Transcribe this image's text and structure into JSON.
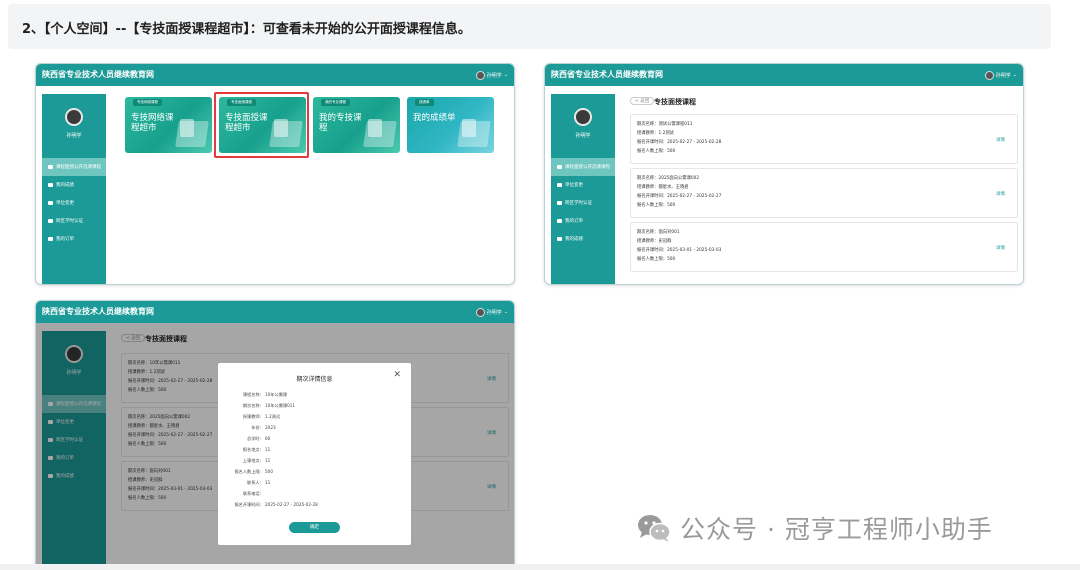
{
  "heading": "2、【个人空间】--【专技面授课程超市】：可查看未开始的公开面授课程信息。",
  "common": {
    "site_title": "陕西省专业技术人员继续教育网",
    "user_name": "孙明学",
    "caret": "⌄",
    "side_name": "孙明学"
  },
  "shot1": {
    "menu": [
      "课程面授公开选课课程",
      "我的成绩",
      "单位变更",
      "跨区学时认证",
      "我的订单"
    ],
    "tiles": [
      {
        "tag": "专技网络课程",
        "label": "专技网络课程超市"
      },
      {
        "tag": "专技面授课程",
        "label": "专技面授课程超市"
      },
      {
        "tag": "我的专业课程",
        "label": "我的专技课程"
      },
      {
        "tag": "成绩单",
        "label": "我的成绩单"
      }
    ]
  },
  "shot2": {
    "menu": [
      "课程面授公开选课课程",
      "单位变更",
      "跨区学时认证",
      "我的订单",
      "我的成绩"
    ],
    "back": "< 返回",
    "title": "专技面授课程",
    "detail": "详情",
    "courses": [
      [
        "期次名称：测试公需课程011",
        "授课教师：1.2测试",
        "报名开课时间：2025-02-27 - 2025-02-28",
        "报名人数上限：500"
      ],
      [
        "期次名称：2025面向公需课002",
        "授课教师：都星水、王晓君",
        "报名开课时间：2025-02-27 - 2025-02-27",
        "报名人数上限：500"
      ],
      [
        "期次名称：面向对001",
        "授课教师：史冠群",
        "报名开课时间：2025-03-01 - 2025-03-03",
        "报名人数上限：500"
      ]
    ]
  },
  "shot3": {
    "menu": [
      "课程面授公开选课课程",
      "单位变更",
      "跨区学时认证",
      "我的订单",
      "我的成绩"
    ],
    "back": "< 返回",
    "title": "专技面授课程",
    "detail": "详情",
    "courses": [
      [
        "期次名称：10年公需课011",
        "授课教师：1.2测试",
        "报名开课时间：2025-02-27 - 2025-02-28",
        "报名人数上限：500"
      ],
      [
        "期次名称：2025面向公需课002",
        "授课教师：都星水、王晓君",
        "报名开课时间：2025-02-27 - 2025-02-27",
        "报名人数上限：500"
      ],
      [
        "期次名称：面向对001",
        "授课教师：史冠群",
        "报名开课时间：2025-03-01 - 2025-03-03",
        "报名人数上限：500"
      ]
    ],
    "modal": {
      "title": "期次详情信息",
      "close": "✕",
      "rows": [
        {
          "k": "课程名称:",
          "v": "10年公需课"
        },
        {
          "k": "期次名称:",
          "v": "10年公需课011"
        },
        {
          "k": "授课教师:",
          "v": "1.2测试"
        },
        {
          "k": "年份:",
          "v": "2023"
        },
        {
          "k": "总学时:",
          "v": "60"
        },
        {
          "k": "报名地点:",
          "v": "11"
        },
        {
          "k": "上课地点:",
          "v": "11"
        },
        {
          "k": "报名人数上限:",
          "v": "500"
        },
        {
          "k": "联系人:",
          "v": "11"
        },
        {
          "k": "联系电话:",
          "v": ""
        },
        {
          "k": "报名开课时间:",
          "v": "2025-02-27 - 2025-02-28"
        }
      ],
      "ok": "确定"
    }
  },
  "watermark": "公众号 · 冠亨工程师小助手"
}
